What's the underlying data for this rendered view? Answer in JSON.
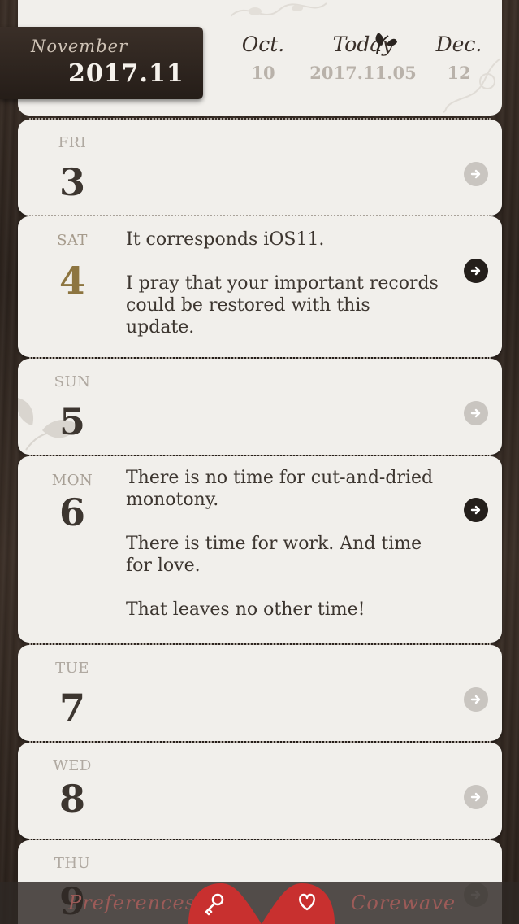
{
  "header": {
    "month_name": "November",
    "month_year": "2017.11",
    "prev": {
      "label": "Oct.",
      "value": "10"
    },
    "today": {
      "label": "Today",
      "value": "2017.11.05"
    },
    "next": {
      "label": "Dec.",
      "value": "12"
    }
  },
  "days": [
    {
      "dow": "FRI",
      "num": "3",
      "note": []
    },
    {
      "dow": "SAT",
      "num": "4",
      "note": [
        "It corresponds iOS11.",
        "I pray that your important records could be restored with this update."
      ]
    },
    {
      "dow": "SUN",
      "num": "5",
      "note": []
    },
    {
      "dow": "MON",
      "num": "6",
      "note": [
        "There is no time for cut-and-dried monotony.",
        "There is time for work. And time for love.",
        "That leaves no other time!"
      ]
    },
    {
      "dow": "TUE",
      "num": "7",
      "note": []
    },
    {
      "dow": "WED",
      "num": "8",
      "note": []
    },
    {
      "dow": "THU",
      "num": "9",
      "note": []
    }
  ],
  "bottom": {
    "preferences_label": "Preferences",
    "corewave_label": "Corewave"
  },
  "colors": {
    "paper": "#f1efeb",
    "saturday_number": "#8d7540",
    "accent_red": "#c8302f"
  },
  "icons": {
    "note_arrow": "arrow-right-circle-icon",
    "preferences": "key-icon",
    "corewave": "heart-icon",
    "today": "leaf-icon"
  }
}
